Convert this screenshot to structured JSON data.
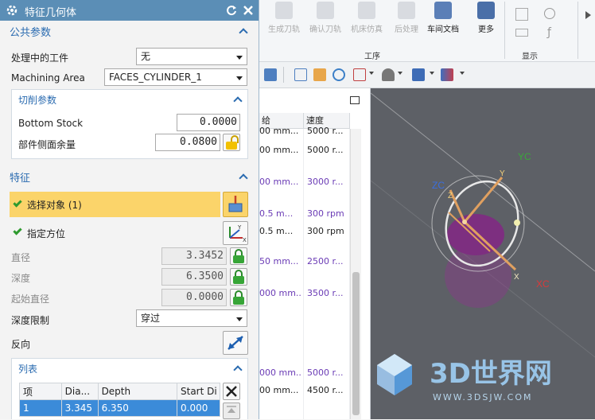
{
  "dialog": {
    "title": "特征几何体",
    "common": {
      "header": "公共参数",
      "workpiece_label": "处理中的工件",
      "workpiece_value": "无",
      "machining_area_label": "Machining Area",
      "machining_area_value": "FACES_CYLINDER_1",
      "cutting": {
        "header": "切削参数",
        "bottom_stock_label": "Bottom Stock",
        "bottom_stock_value": "0.0000",
        "side_stock_label": "部件侧面余量",
        "side_stock_value": "0.0800"
      }
    },
    "feature": {
      "header": "特征",
      "select_object_label": "选择对象 (1)",
      "specify_orientation_label": "指定方位",
      "diameter_label": "直径",
      "diameter_value": "3.3452",
      "depth_label": "深度",
      "depth_value": "6.3500",
      "start_diameter_label": "起始直径",
      "start_diameter_value": "0.0000",
      "depth_limit_label": "深度限制",
      "depth_limit_value": "穿过",
      "reverse_label": "反向",
      "list": {
        "header": "列表",
        "columns": [
          "项",
          "Dia...",
          "Depth",
          "Start Di"
        ],
        "rows": [
          [
            "1",
            "3.345",
            "6.350",
            "0.000"
          ]
        ]
      }
    }
  },
  "ribbon": {
    "buttons": [
      "生成刀轨",
      "确认刀轨",
      "机床仿真",
      "后处理",
      "车间文档",
      "更多"
    ],
    "groups": [
      "工序",
      "显示"
    ]
  },
  "op_table": {
    "columns": [
      "给",
      "速度"
    ],
    "rows": [
      {
        "feed": "00 mm...",
        "speed": "5000 r...",
        "purple": false
      },
      {
        "feed": "00 mm...",
        "speed": "5000 r...",
        "purple": false
      },
      {
        "feed": "00 mm...",
        "speed": "3000 r...",
        "purple": true
      },
      {
        "feed": "0.5 m...",
        "speed": "300 rpm",
        "purple": true
      },
      {
        "feed": "0.5 m...",
        "speed": "300 rpm",
        "purple": false
      },
      {
        "feed": "50 mm...",
        "speed": "2500 r...",
        "purple": true
      },
      {
        "feed": "000 mm...",
        "speed": "3500 r...",
        "purple": true
      },
      {
        "feed": "000 mm...",
        "speed": "5000 r...",
        "purple": true
      },
      {
        "feed": "00 mm...",
        "speed": "4500 r...",
        "purple": false
      }
    ]
  },
  "viewport": {
    "axis_labels": {
      "yc": "YC",
      "zc": "ZC",
      "xc": "XC",
      "y": "Y",
      "z": "Z",
      "x": "X"
    },
    "watermark_main": "3D世界网",
    "watermark_url": "WWW.3DSJW.COM"
  }
}
